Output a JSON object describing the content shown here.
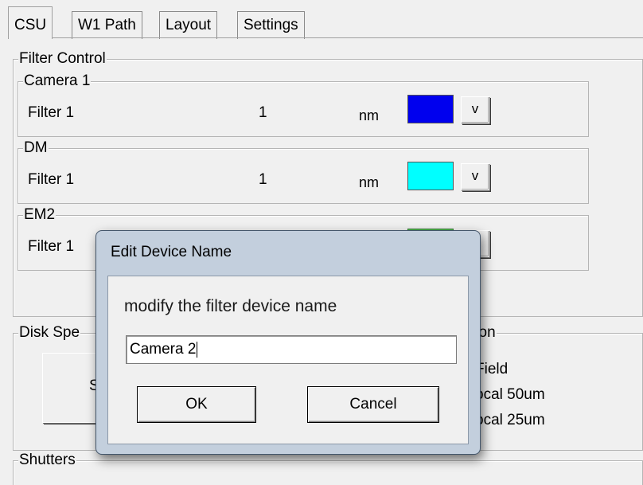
{
  "tabs": [
    "CSU",
    "W1 Path",
    "Layout",
    "Settings"
  ],
  "filter_control": {
    "legend": "Filter Control",
    "groups": [
      {
        "legend": "Camera 1",
        "filter_label": "Filter 1",
        "value": "1",
        "unit": "nm",
        "color": "#0000ee",
        "button": "v"
      },
      {
        "legend": "DM",
        "filter_label": "Filter 1",
        "value": "1",
        "unit": "nm",
        "color": "#00ffff",
        "button": "v"
      },
      {
        "legend": "EM2",
        "filter_label": "Filter 1",
        "value": "",
        "unit": "",
        "color": "#4bc14b",
        "button": ""
      }
    ]
  },
  "disk_speed": {
    "legend": "Disk Spe",
    "button_partial": "Sto"
  },
  "position": {
    "legend": "tion",
    "options": [
      "Field",
      "ocal 50um",
      "ocal 25um"
    ]
  },
  "shutters": {
    "legend": "Shutters"
  },
  "dialog": {
    "title": "Edit Device Name",
    "prompt": "modify the filter device name",
    "input_value": "Camera 2",
    "ok_label": "OK",
    "cancel_label": "Cancel"
  }
}
